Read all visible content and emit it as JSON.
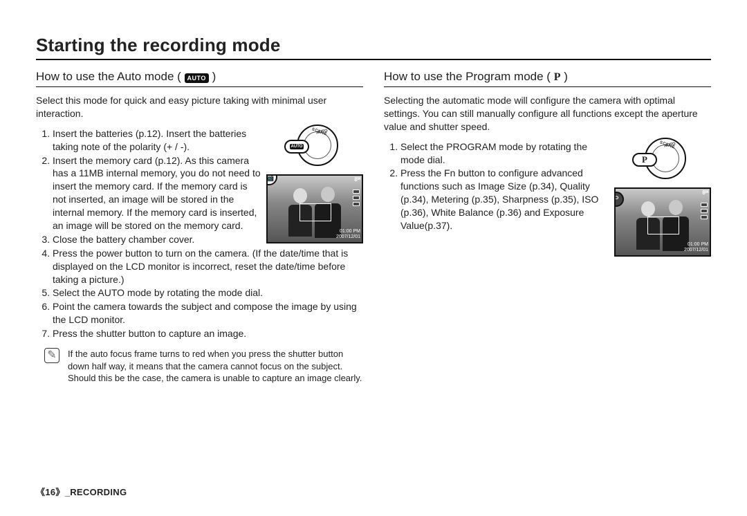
{
  "title": "Starting the recording mode",
  "left": {
    "heading": "How to use the Auto mode (",
    "heading_tail": ")",
    "mode_icon_label": "AUTO",
    "intro": "Select this mode for quick and easy picture taking with minimal user interaction.",
    "steps": [
      "Insert the batteries (p.12). Insert the batteries taking note of the polarity (+ / -).",
      "Insert the memory card (p.12). As this camera has a 11MB internal memory, you do not need to insert the memory card. If the memory card is not inserted, an image will be stored in the internal memory. If the memory card is inserted, an image will be stored on the memory card.",
      "Close the battery chamber cover.",
      "Press the power button to turn on the camera. (If the date/time that is displayed on the LCD monitor is incorrect, reset the date/time before taking a picture.)",
      "Select the AUTO mode by rotating the mode dial.",
      "Point the camera towards the subject and compose the image by using the LCD monitor.",
      "Press the shutter button to capture an image."
    ],
    "note_icon": "✎",
    "note": "If the auto focus frame turns to red when you press the shutter button down half way, it means that the camera cannot focus on the subject. Should this be the case, the camera is unable to capture an image clearly.",
    "dial": {
      "scene_text": "SCENE",
      "auto_text": "AUTO",
      "highlight_label": "AUTO"
    },
    "lcd": {
      "top_right": "8",
      "bottom_time": "01:00 PM",
      "bottom_date": "2007/12/01",
      "cam_icon": "📷"
    }
  },
  "right": {
    "heading": "How to use the Program mode (",
    "heading_tail": ")",
    "mode_icon_label": "P",
    "intro": "Selecting the automatic mode will configure the camera with optimal settings. You can still manually configure all functions except the aperture value and shutter speed.",
    "steps": [
      "Select the PROGRAM mode by rotating the mode dial.",
      "Press the Fn button to configure advanced functions such as Image Size (p.34), Quality (p.34), Metering (p.35), Sharpness (p.35), ISO (p.36), White Balance (p.36) and Exposure Value(p.37)."
    ],
    "dial": {
      "scene_text": "SCENE",
      "auto_text": "AUTO",
      "highlight_label": "P"
    },
    "lcd": {
      "top_right": "8",
      "bottom_time": "01:00 PM",
      "bottom_date": "2007/12/01",
      "badge": "P"
    }
  },
  "footer": {
    "open": "《",
    "page": "16",
    "close": "》",
    "section": "_RECORDING"
  }
}
